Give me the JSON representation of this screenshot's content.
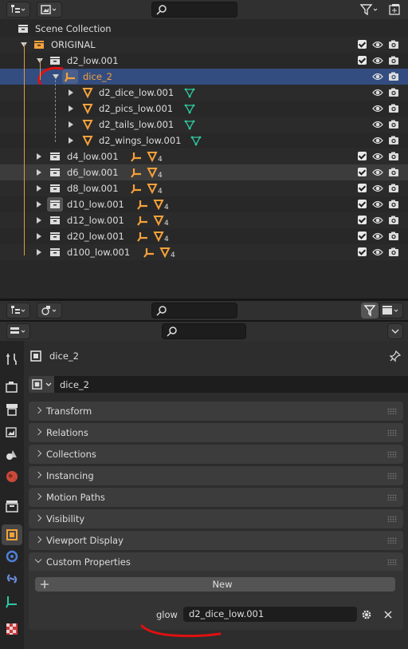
{
  "outliner": {
    "search_placeholder": "",
    "scene_collection": "Scene Collection",
    "original": "ORIGINAL",
    "d2_low": "d2_low.001",
    "dice_2": "dice_2",
    "d2_children": [
      "d2_dice_low.001",
      "d2_pics_low.001",
      "d2_tails_low.001",
      "d2_wings_low.001"
    ],
    "collections": [
      {
        "name": "d4_low.001",
        "count": "4"
      },
      {
        "name": "d6_low.001",
        "count": "4"
      },
      {
        "name": "d8_low.001",
        "count": "4"
      },
      {
        "name": "d10_low.001",
        "count": "4"
      },
      {
        "name": "d12_low.001",
        "count": "4"
      },
      {
        "name": "d20_low.001",
        "count": "4"
      },
      {
        "name": "d100_low.001",
        "count": "4"
      }
    ]
  },
  "properties": {
    "search_placeholder": "",
    "object_title": "dice_2",
    "object_name_field": "dice_2",
    "panels": [
      "Transform",
      "Relations",
      "Collections",
      "Instancing",
      "Motion Paths",
      "Visibility",
      "Viewport Display",
      "Custom Properties"
    ],
    "new_button": "New",
    "custom_prop_key": "glow",
    "custom_prop_value": "d2_dice_low.001"
  },
  "colors": {
    "selection": "#334d80",
    "collection_orange": "#f5a13a",
    "mesh_green": "#2fc8a0",
    "annotation_red": "#e01010"
  },
  "icons": [
    "editor-type-icon",
    "display-mode-icon",
    "search-icon",
    "filter-icon",
    "new-collection-icon",
    "eye-icon",
    "camera-icon",
    "armature-icon",
    "mesh-icon",
    "pin-icon",
    "gear-icon",
    "close-icon",
    "plus-icon"
  ]
}
